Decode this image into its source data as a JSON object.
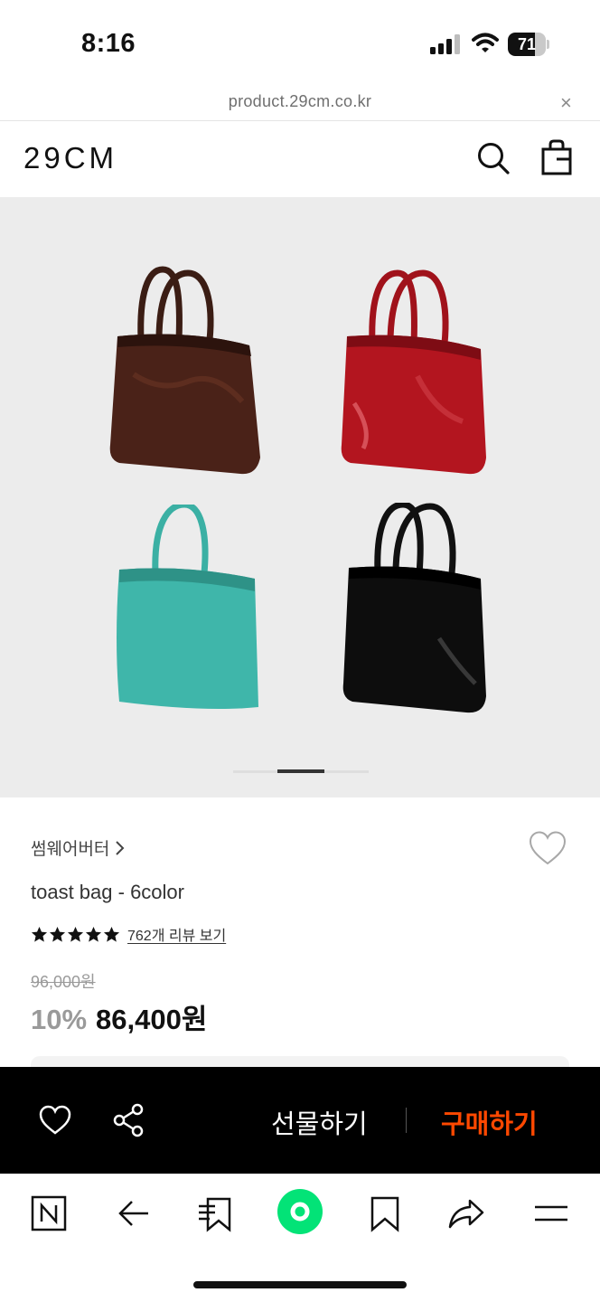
{
  "status_bar": {
    "time": "8:16",
    "battery_level": "71",
    "battery_fraction": 0.71
  },
  "url_bar": {
    "url": "product.29cm.co.kr",
    "close_glyph": "×"
  },
  "header": {
    "logo": "29CM",
    "icons": [
      "search-icon",
      "shopping-bag-icon"
    ]
  },
  "gallery": {
    "bag_colors": [
      "#4a2218",
      "#b3151f",
      "#3fb6aa",
      "#0d0d0d"
    ],
    "slide_indicator": "1"
  },
  "product": {
    "brand": "썸웨어버터",
    "name": "toast bag - 6color",
    "rating_stars": 5,
    "review_link": "762개 리뷰 보기",
    "original_price": "96,000원",
    "discount": "10%",
    "price": "86,400원"
  },
  "buy_bar": {
    "gift_label": "선물하기",
    "buy_label": "구매하기",
    "buy_color": "#ff4800"
  },
  "toolbar": {
    "items": [
      "naver-n-icon",
      "back-arrow-icon",
      "bookmark-list-icon",
      "green-dot-icon",
      "bookmark-icon",
      "share-arrow-icon",
      "menu-icon"
    ],
    "accent_color": "#03e377"
  }
}
